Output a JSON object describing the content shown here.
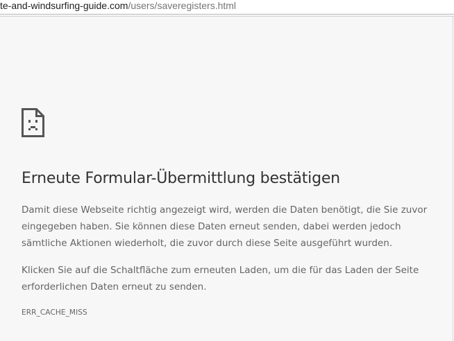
{
  "browser": {
    "url_host": "te-and-windsurfing-guide.com",
    "url_path": "/users/saveregisters.html"
  },
  "error_page": {
    "icon": "sad-page-icon",
    "title": "Erneute Formular-Übermittlung bestätigen",
    "paragraph_1": "Damit diese Webseite richtig angezeigt wird, werden die Daten benötigt, die Sie zuvor eingegeben haben. Sie können diese Daten erneut senden, dabei werden jedoch sämtliche Aktionen wiederholt, die zuvor durch diese Seite ausgeführt wurden.",
    "paragraph_2": "Klicken Sie auf die Schaltfläche zum erneuten Laden, um die für das Laden der Seite erforderlichen Daten erneut zu senden.",
    "error_code": "ERR_CACHE_MISS"
  },
  "colors": {
    "background": "#f7f7f7",
    "heading": "#333333",
    "body_text": "#646464"
  }
}
